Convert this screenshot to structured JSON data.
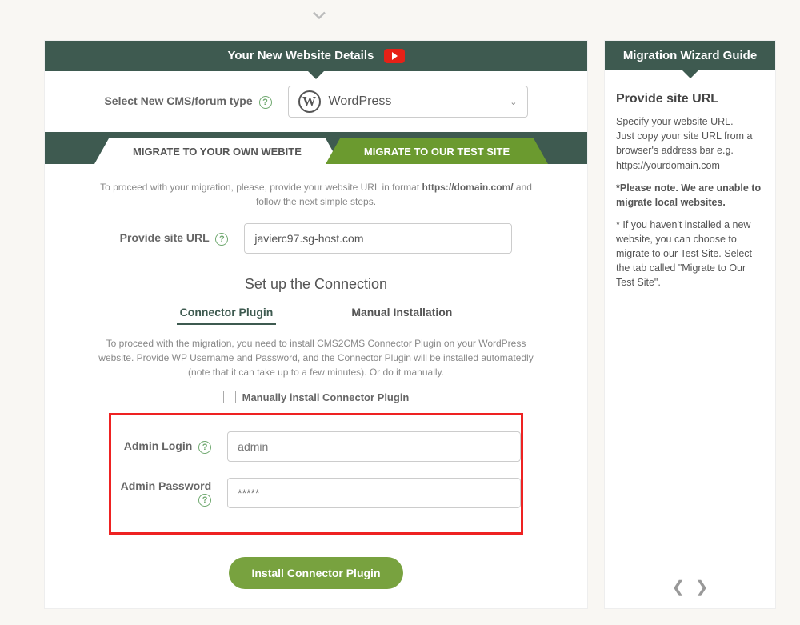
{
  "header": {
    "title": "Your New Website Details"
  },
  "cms": {
    "label": "Select New CMS/forum type",
    "selected": "WordPress"
  },
  "tabs": {
    "own": "MIGRATE TO YOUR OWN WEBITE",
    "test": "MIGRATE TO OUR TEST SITE"
  },
  "instructions": {
    "pre": "To proceed with your migration, please, provide your website URL in format ",
    "bold": "https://domain.com/",
    "post": " and follow the next simple steps."
  },
  "url": {
    "label": "Provide site URL",
    "value": "javierc97.sg-host.com"
  },
  "connection": {
    "title": "Set up the Connection",
    "tab_plugin": "Connector Plugin",
    "tab_manual": "Manual Installation",
    "text": "To proceed with the migration, you need to install CMS2CMS Connector Plugin on your WordPress website. Provide WP Username and Password, and the Connector Plugin will be installed automatedly (note that it can take up to a few minutes). Or do it manually.",
    "manual_check": "Manually install Connector Plugin",
    "login_label": "Admin Login",
    "login_placeholder": "admin",
    "pass_label": "Admin Password",
    "pass_placeholder": "*****",
    "button": "Install Connector Plugin"
  },
  "guide": {
    "title": "Migration Wizard Guide",
    "heading": "Provide site URL",
    "p1": "Specify your website URL.\nJust copy your site URL from a browser's address bar e.g. https://yourdomain.com",
    "p2": "*Please note. We are unable to migrate local websites.",
    "p3": "* If you haven't installed a new website, you can choose to migrate to our Test Site. Select the tab called \"Migrate to Our Test Site\"."
  }
}
